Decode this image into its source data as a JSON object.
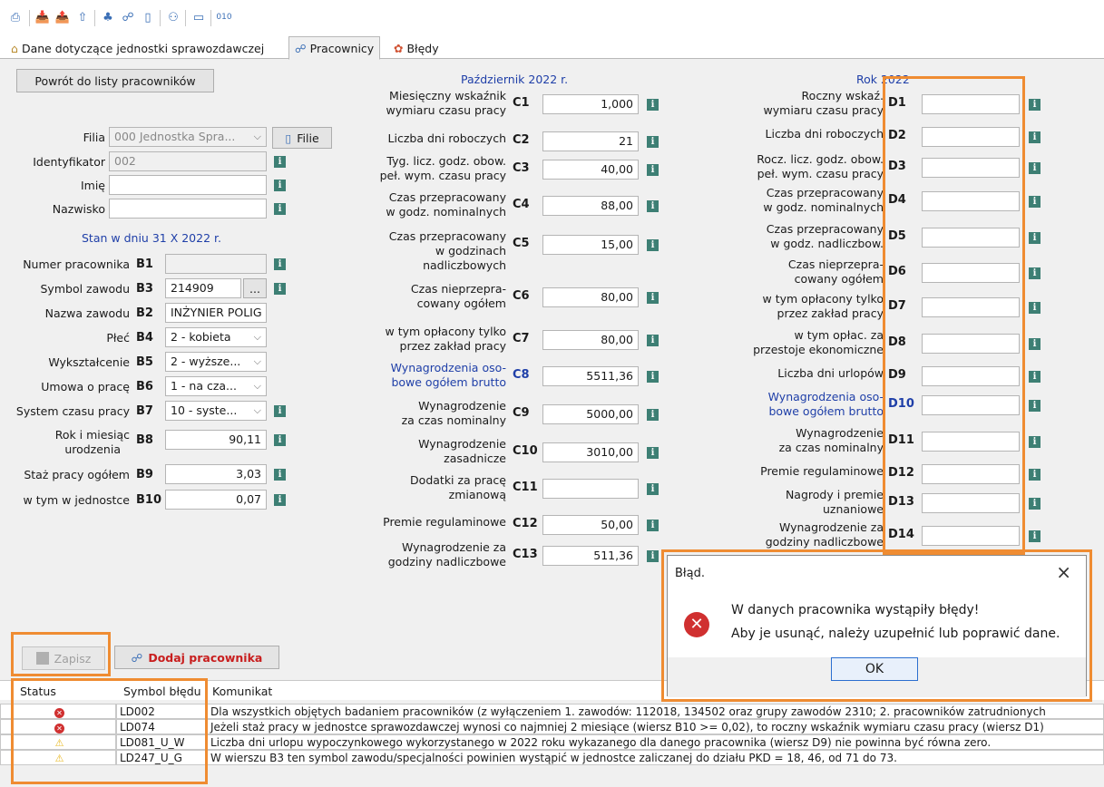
{
  "toolbar": {
    "icons": [
      "printer-icon",
      "inbox-icon",
      "export-icon",
      "arrow-up-icon",
      "tree-icon",
      "workers-icon",
      "battery-icon",
      "users-icon",
      "document-icon",
      "binary-icon"
    ]
  },
  "tabs": [
    {
      "label": "Dane dotyczące jednostki sprawozdawczej",
      "icon": "home-icon"
    },
    {
      "label": "Pracownicy",
      "icon": "workers-icon",
      "active": true
    },
    {
      "label": "Błędy",
      "icon": "error-icon"
    }
  ],
  "left": {
    "back_button": "Powrót do listy pracowników",
    "filia_label": "Filia",
    "filia_value": "000 Jednostka Spra...",
    "filie_button": "Filie",
    "id_label": "Identyfikator",
    "id_value": "002",
    "imie_label": "Imię",
    "imie_value": "",
    "nazwisko_label": "Nazwisko",
    "nazwisko_value": "",
    "section_title": "Stan w dniu 31 X 2022 r.",
    "b1_label": "Numer pracownika",
    "b1_code": "B1",
    "b1_value": "",
    "b3_label": "Symbol zawodu",
    "b3_code": "B3",
    "b3_value": "214909",
    "b3_btn": "...",
    "b2_label": "Nazwa zawodu",
    "b2_code": "B2",
    "b2_value": "INŻYNIER POLIG",
    "b4_label": "Płeć",
    "b4_code": "B4",
    "b4_value": "2 - kobieta",
    "b5_label": "Wykształcenie",
    "b5_code": "B5",
    "b5_value": "2 - wyższe...",
    "b6_label": "Umowa o pracę",
    "b6_code": "B6",
    "b6_value": "1 - na cza...",
    "b7_label": "System czasu pracy",
    "b7_code": "B7",
    "b7_value": "10 - syste...",
    "b8_label1": "Rok i miesiąc",
    "b8_label2": "urodzenia",
    "b8_code": "B8",
    "b8_value": "90,11",
    "b9_label": "Staż pracy ogółem",
    "b9_code": "B9",
    "b9_value": "3,03",
    "b10_label": "w tym w jednostce",
    "b10_code": "B10",
    "b10_value": "0,07"
  },
  "middle": {
    "header": "Październik 2022 r.",
    "rows": [
      {
        "l1": "Miesięczny wskaźnik",
        "l2": "wymiaru czasu pracy",
        "code": "C1",
        "value": "1,000"
      },
      {
        "l1": "Liczba dni roboczych",
        "l2": "",
        "code": "C2",
        "value": "21"
      },
      {
        "l1": "Tyg. licz. godz. obow.",
        "l2": "peł. wym. czasu pracy",
        "code": "C3",
        "value": "40,00"
      },
      {
        "l1": "Czas przepracowany",
        "l2": "w godz. nominalnych",
        "code": "C4",
        "value": "88,00"
      },
      {
        "l1": "Czas przepracowany",
        "l2": "w godzinach",
        "l3": "nadliczbowych",
        "code": "C5",
        "value": "15,00"
      },
      {
        "l1": "Czas nieprzepra-",
        "l2": "cowany ogółem",
        "code": "C6",
        "value": "80,00"
      },
      {
        "l1": "w tym opłacony tylko",
        "l2": "przez zakład pracy",
        "code": "C7",
        "value": "80,00"
      },
      {
        "l1": "Wynagrodzenia oso-",
        "l2": "bowe ogółem brutto",
        "code": "C8",
        "value": "5511,36"
      },
      {
        "l1": "Wynagrodzenie",
        "l2": "za czas nominalny",
        "code": "C9",
        "value": "5000,00"
      },
      {
        "l1": "Wynagrodzenie",
        "l2": "zasadnicze",
        "code": "C10",
        "value": "3010,00"
      },
      {
        "l1": "Dodatki za pracę",
        "l2": "zmianową",
        "code": "C11",
        "value": ""
      },
      {
        "l1": "Premie regulaminowe",
        "l2": "",
        "code": "C12",
        "value": "50,00"
      },
      {
        "l1": "Wynagrodzenie za",
        "l2": "godziny nadliczbowe",
        "code": "C13",
        "value": "511,36"
      }
    ]
  },
  "right": {
    "header": "Rok 2022",
    "rows": [
      {
        "l1": "Roczny wskaź.",
        "l2": "wymiaru czasu pracy",
        "code": "D1"
      },
      {
        "l1": "Liczba dni roboczych",
        "l2": "",
        "code": "D2"
      },
      {
        "l1": "Rocz. licz. godz. obow.",
        "l2": "peł. wym. czasu pracy",
        "code": "D3"
      },
      {
        "l1": "Czas przepracowany",
        "l2": "w godz. nominalnych",
        "code": "D4"
      },
      {
        "l1": "Czas przepracowany",
        "l2": "w godz. nadliczbow.",
        "code": "D5"
      },
      {
        "l1": "Czas nieprzepra-",
        "l2": "cowany ogółem",
        "code": "D6"
      },
      {
        "l1": "w tym opłacony tylko",
        "l2": "przez zakład pracy",
        "code": "D7"
      },
      {
        "l1": "w tym opłac. za",
        "l2": "przestoje ekonomiczne",
        "code": "D8"
      },
      {
        "l1": "Liczba dni urlopów",
        "l2": "",
        "code": "D9"
      },
      {
        "l1": "Wynagrodzenia oso-",
        "l2": "bowe ogółem brutto",
        "code": "D10"
      },
      {
        "l1": "Wynagrodzenie",
        "l2": "za czas nominalny",
        "code": "D11"
      },
      {
        "l1": "Premie regulaminowe",
        "l2": "",
        "code": "D12"
      },
      {
        "l1": "Nagrody i premie",
        "l2": "uznaniowe",
        "code": "D13"
      },
      {
        "l1": "Wynagrodzenie za",
        "l2": "godziny nadliczbowe",
        "code": "D14"
      }
    ]
  },
  "actions": {
    "save": "Zapisz",
    "add": "Dodaj pracownika"
  },
  "errors": {
    "headers": {
      "status": "Status",
      "symbol": "Symbol błędu",
      "message": "Komunikat"
    },
    "rows": [
      {
        "status": "error",
        "symbol": "LD002",
        "message": "Dla wszystkich objętych badaniem pracowników (z wyłączeniem 1. zawodów: 112018, 134502 oraz grupy zawodów 2310; 2. pracowników zatrudnionych"
      },
      {
        "status": "error",
        "symbol": "LD074",
        "message": "Jeżeli staż pracy w jednostce sprawozdawczej wynosi co najmniej 2 miesiące (wiersz B10 >= 0,02), to roczny wskaźnik wymiaru czasu pracy (wiersz D1)"
      },
      {
        "status": "warning",
        "symbol": "LD081_U_W",
        "message": "Liczba dni urlopu wypoczynkowego wykorzystanego w 2022 roku wykazanego dla danego pracownika (wiersz D9) nie powinna być równa zero."
      },
      {
        "status": "warning",
        "symbol": "LD247_U_G",
        "message": "W wierszu B3 ten symbol zawodu/specjalności powinien wystąpić w jednostce zaliczanej do działu PKD = 18, 46, od 71 do 73."
      }
    ]
  },
  "dialog": {
    "title": "Błąd.",
    "line1": "W danych pracownika wystąpiły błędy!",
    "line2": "Aby je usunąć, należy uzupełnić lub poprawić dane.",
    "ok": "OK",
    "close": "×"
  },
  "colors": {
    "accent": "#1f3fa8",
    "highlight": "#ef8c32",
    "info": "#3d7f74",
    "error": "#d03030",
    "warning": "#e8b820",
    "add_button_text": "#c81e1e"
  }
}
